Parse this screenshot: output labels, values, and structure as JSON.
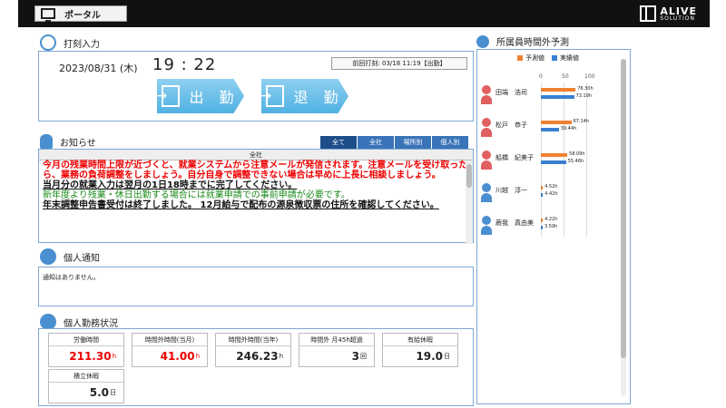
{
  "header": {
    "portal_label": "ポータル",
    "logo_line1": "ALIVE",
    "logo_line2": "SOLUTION"
  },
  "punch": {
    "title": "打刻入力",
    "date": "2023/08/31 (木)",
    "time": "19 : 22",
    "previous": "前回打刻: 03/18 11:19【出勤】",
    "clock_in_label": "出 勤",
    "clock_out_label": "退 勤"
  },
  "notice": {
    "title": "お知らせ",
    "tabs": [
      "全て",
      "全社",
      "場所別",
      "個人別"
    ],
    "header": "全社",
    "lines": [
      {
        "text": "今月の残業時間上限が近づくと、就業システムから注意メールが発信されます。注意メールを受け取ったら、業務の負荷調整をしましょう。自分自身で調整できない場合は早めに上長に相談しましょう。",
        "style": "red"
      },
      {
        "text": "当月分の就業入力は翌月の1日18時までに完了してください。",
        "style": "blk"
      },
      {
        "text": "新年度より残業・休日出勤する場合には就業申請での事前申請が必要です。",
        "style": "grn"
      },
      {
        "text": "年末調整申告書受付は終了しました。 12月給与で配布の源泉徴収票の住所を確認してください。",
        "style": "blk"
      }
    ]
  },
  "personal_notice": {
    "title": "個人通知",
    "message": "通知はありません。"
  },
  "work_status": {
    "title": "個人勤務状況",
    "items": [
      {
        "label": "労働時間",
        "value": "211.30",
        "unit": "h",
        "highlight": "#e00000"
      },
      {
        "label": "時間外時間(当月)",
        "value": "41.00",
        "unit": "h",
        "highlight": "#e00000"
      },
      {
        "label": "時間外時間(当年)",
        "value": "246.23",
        "unit": "h",
        "highlight": ""
      },
      {
        "label": "時間外 月45h超過",
        "value": "3",
        "unit": "回",
        "highlight": ""
      },
      {
        "label": "有給休暇",
        "value": "19.0",
        "unit": "日",
        "highlight": ""
      },
      {
        "label": "積立休暇",
        "value": "5.0",
        "unit": "日",
        "highlight": ""
      }
    ]
  },
  "overtime_forecast": {
    "title": "所属員時間外予測",
    "legend": [
      "予測値",
      "実績値"
    ],
    "colors": {
      "plan": "#f08030",
      "actual": "#3a7fd0",
      "female": "#e06060",
      "male": "#4a8fd0"
    },
    "axis_ticks": [
      "0",
      "50",
      "100"
    ],
    "people": [
      {
        "name": "田端　浩司",
        "gender": "female",
        "plan": 76.3,
        "actual": 73.19,
        "plan_label": "76.30h",
        "actual_label": "73.19h"
      },
      {
        "name": "松戸　恭子",
        "gender": "female",
        "plan": 67.14,
        "actual": 39.44,
        "plan_label": "67.14h",
        "actual_label": "39.44h"
      },
      {
        "name": "船橋　紀美子",
        "gender": "female",
        "plan": 58.09,
        "actual": 55.46,
        "plan_label": "58.09h",
        "actual_label": "55.46h"
      },
      {
        "name": "川越　淳一",
        "gender": "male",
        "plan": 4.52,
        "actual": 4.42,
        "plan_label": "4.52h",
        "actual_label": "4.42h"
      },
      {
        "name": "蕨我　真由美",
        "gender": "male",
        "plan": 4.22,
        "actual": 3.59,
        "plan_label": "4.22h",
        "actual_label": "3.59h"
      }
    ]
  }
}
